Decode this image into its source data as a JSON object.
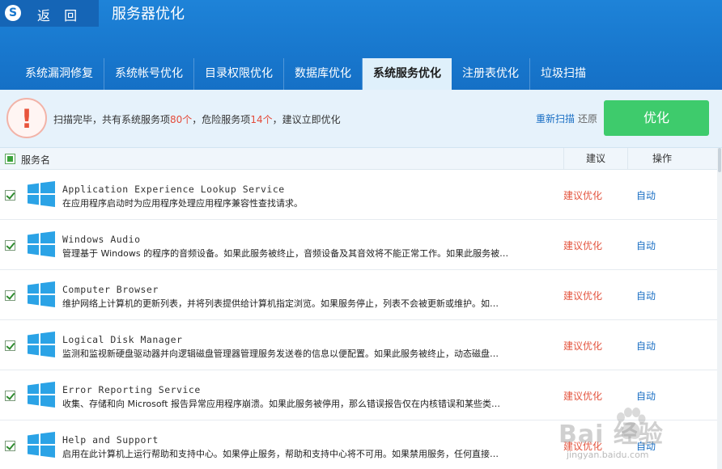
{
  "header": {
    "logo_letter": "S",
    "back_label": "返 回",
    "title": "服务器优化"
  },
  "tabs": [
    {
      "label": "系统漏洞修复",
      "active": false
    },
    {
      "label": "系统帐号优化",
      "active": false
    },
    {
      "label": "目录权限优化",
      "active": false
    },
    {
      "label": "数据库优化",
      "active": false
    },
    {
      "label": "系统服务优化",
      "active": true
    },
    {
      "label": "注册表优化",
      "active": false
    },
    {
      "label": "垃圾扫描",
      "active": false
    }
  ],
  "status": {
    "icon": "exclamation-icon",
    "prefix": "扫描完毕，共有系统服务项",
    "total": "80个",
    "middle": "，危险服务项",
    "danger": "14个",
    "suffix": "，建议立即优化",
    "rescan_label": "重新扫描",
    "restore_label": "还原",
    "optimize_label": "优化"
  },
  "table": {
    "col_name": "服务名",
    "col_advice": "建议",
    "col_op": "操作",
    "rows": [
      {
        "name": "Application Experience Lookup Service",
        "desc": "在应用程序启动时为应用程序处理应用程序兼容性查找请求。",
        "advice": "建议优化",
        "op": "自动"
      },
      {
        "name": "Windows Audio",
        "desc": "管理基于 Windows 的程序的音频设备。如果此服务被终止，音频设备及其音效将不能正常工作。如果此服务被…",
        "advice": "建议优化",
        "op": "自动"
      },
      {
        "name": "Computer Browser",
        "desc": "维护网络上计算机的更新列表，并将列表提供给计算机指定浏览。如果服务停止，列表不会被更新或维护。如…",
        "advice": "建议优化",
        "op": "自动"
      },
      {
        "name": "Logical Disk Manager",
        "desc": "监测和监视新硬盘驱动器并向逻辑磁盘管理器管理服务发送卷的信息以便配置。如果此服务被终止，动态磁盘…",
        "advice": "建议优化",
        "op": "自动"
      },
      {
        "name": "Error Reporting Service",
        "desc": "收集、存储和向 Microsoft 报告异常应用程序崩溃。如果此服务被停用，那么错误报告仅在内核错误和某些类…",
        "advice": "建议优化",
        "op": "自动"
      },
      {
        "name": "Help and Support",
        "desc": "启用在此计算机上运行帮助和支持中心。如果停止服务，帮助和支持中心将不可用。如果禁用服务，任何直接…",
        "advice": "建议优化",
        "op": "自动"
      }
    ]
  },
  "watermark": {
    "logo": "Bai 经验",
    "url": "jingyan.baidu.com"
  },
  "colors": {
    "header_blue": "#1877cd",
    "optimize_green": "#3ecb6c",
    "danger_red": "#e44b3a",
    "link_blue": "#1a6fc4",
    "windows_logo": "#2ba3e6"
  }
}
